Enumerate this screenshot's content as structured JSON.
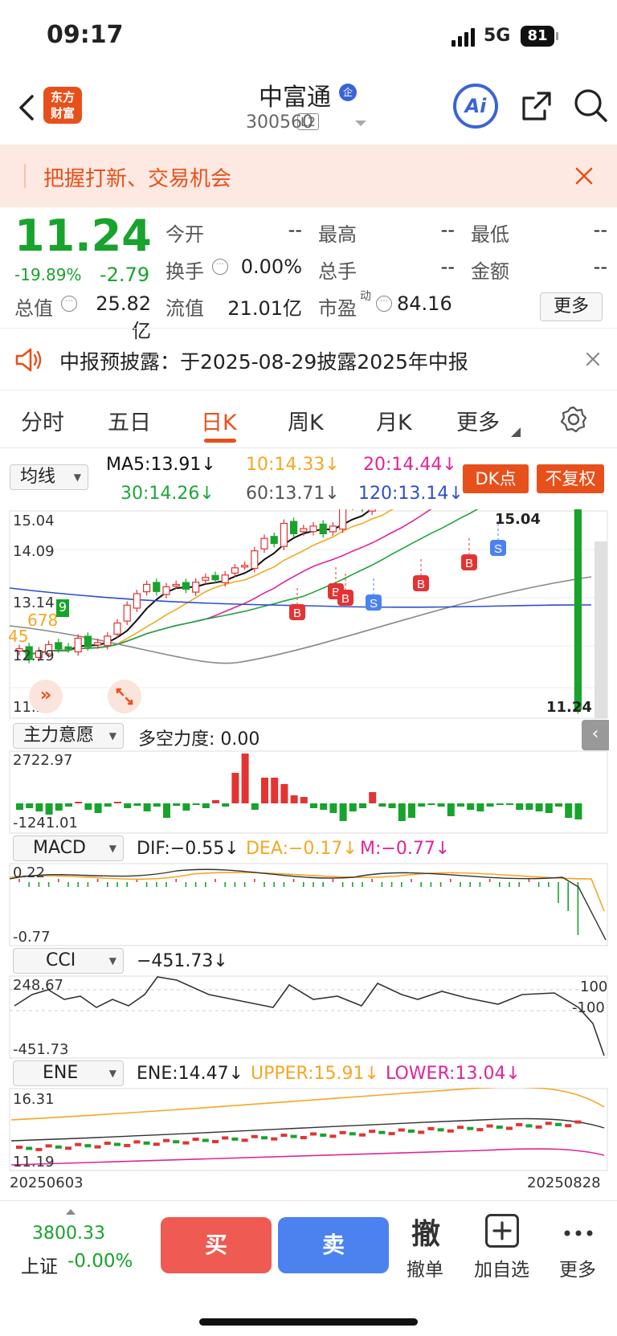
{
  "status": {
    "time": "09:17",
    "network": "5G",
    "battery": "81"
  },
  "header": {
    "logo_line1": "东方",
    "logo_line2": "财富",
    "title": "中富通",
    "badge": "企",
    "code": "300560",
    "level": "L2",
    "ai_label": "Ai"
  },
  "banner": {
    "text": "把握打新、交易机会"
  },
  "quote": {
    "price": "11.24",
    "pct": "-19.89%",
    "chg": "-2.79",
    "open_label": "今开",
    "open_val": "--",
    "high_label": "最高",
    "high_val": "--",
    "low_label": "最低",
    "low_val": "--",
    "turn_label": "换手",
    "turn_val": "0.00%",
    "vol_label": "总手",
    "vol_val": "--",
    "amt_label": "金额",
    "amt_val": "--",
    "cap_label": "总值",
    "cap_val": "25.82亿",
    "float_label": "流值",
    "float_val": "21.01亿",
    "pe_label": "市盈",
    "pe_sup": "动",
    "pe_val": "84.16",
    "more": "更多"
  },
  "notice": {
    "text": "中报预披露：于2025-08-29披露2025年中报"
  },
  "tabs": [
    "分时",
    "五日",
    "日K",
    "周K",
    "月K",
    "更多"
  ],
  "kchart": {
    "ma_select": "均线",
    "ma5": "MA5:13.91↓",
    "ma10": "10:14.33↓",
    "ma20": "20:14.44↓",
    "ma30": "30:14.26↓",
    "ma60": "60:13.71↓",
    "ma120": "120:13.14↓",
    "dk_button": "DK点",
    "fq_button": "不复权",
    "y_labels": [
      "15.04",
      "14.09",
      "13.14",
      "12.19",
      "11.24"
    ],
    "high_marker": "15.04",
    "last_marker": "11.24",
    "left_labels": [
      "45",
      "678",
      "9"
    ],
    "buy_label": "B",
    "sell_label": "S"
  },
  "zl": {
    "select": "主力意愿",
    "title": "多空力度: 0.00",
    "top": "2722.97",
    "bottom": "-1241.01"
  },
  "macd": {
    "select": "MACD",
    "dif": "DIF:−0.55↓",
    "dea": "DEA:−0.17↓",
    "m": "M:−0.77↓",
    "top": "0.22",
    "bottom": "-0.77"
  },
  "cci": {
    "select": "CCI",
    "val": "−451.73↓",
    "top": "248.67",
    "bottom": "-451.73",
    "r100": "100",
    "rm100": "-100"
  },
  "ene": {
    "select": "ENE",
    "ene": "ENE:14.47↓",
    "upper": "UPPER:15.91↓",
    "lower": "LOWER:13.04↓",
    "top": "16.31",
    "bottom": "11.19"
  },
  "dates": {
    "start": "20250603",
    "end": "20250828"
  },
  "footer": {
    "index_val": "3800.33",
    "index_name": "上证",
    "index_chg": "-0.00%",
    "buy": "买",
    "sell": "卖",
    "cancel_icon": "撤",
    "cancel": "撤单",
    "add": "加自选",
    "more": "更多"
  },
  "colors": {
    "up": "#e33333",
    "down": "#18a32c",
    "ma5": "#111111",
    "ma10": "#f5a623",
    "ma20": "#e0249a",
    "ma30": "#1fa53a",
    "ma60": "#888888",
    "ma120": "#2d4fc9",
    "accent": "#e8501b"
  }
}
